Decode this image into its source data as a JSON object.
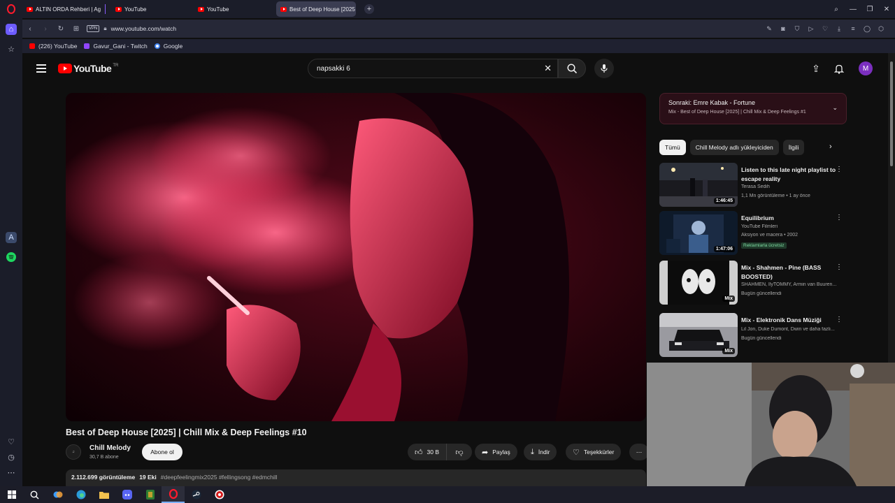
{
  "browser": {
    "tabs": [
      {
        "title": "ALTIN ORDA Rehberi | Ag",
        "active": false
      },
      {
        "title": "YouTube",
        "active": false
      },
      {
        "title": "YouTube",
        "active": false
      },
      {
        "title": "Best of Deep House [2025",
        "active": true
      }
    ],
    "vpn_label": "VPN",
    "url": "www.youtube.com/watch",
    "bookmarks": [
      "(226) YouTube",
      "Gavur_Gani - Twitch",
      "Google"
    ]
  },
  "youtube": {
    "logo_text": "YouTube",
    "logo_country": "TR",
    "search_value": "napsakki 6",
    "avatar_letter": "M",
    "video": {
      "title": "Best of Deep House [2025] | Chill Mix & Deep Feelings #10",
      "channel": "Chill Melody",
      "subscribers": "30,7 B abone",
      "subscribe_label": "Abone ol",
      "likes": "30 B",
      "share_label": "Paylaş",
      "download_label": "İndir",
      "thanks_label": "Teşekkürler",
      "views": "2.112.699 görüntüleme",
      "date": "19 Eki",
      "hashtags": "#deepfeelingmix2025 #fellingsong #edmchill"
    },
    "up_next": {
      "label": "Sonraki: Emre Kabak - Fortune",
      "playlist": "Mix - Best of Deep House [2025] | Chill Mix & Deep Feelings #1"
    },
    "chips": [
      "Tümü",
      "Chill Melody adlı yükleyiciden",
      "İlgili"
    ],
    "recommendations": [
      {
        "title": "Listen to this late night playlist to escape reality",
        "channel": "Terasa Sedih",
        "meta": "1,1 Mn görüntüleme • 1 ay önce",
        "duration": "1:46:45",
        "badge": ""
      },
      {
        "title": "Equilibrium",
        "channel": "YouTube Filmleri",
        "meta": "Aksiyon ve macera • 2002",
        "duration": "1:47:06",
        "badge": "Reklamlarla ücretsiz"
      },
      {
        "title": "Mix - Shahmen - Pine (BASS BOOSTED)",
        "channel": "SHAHMEN, IlyTOMMY, Armin van Buuren...",
        "meta": "Bugün güncellendi",
        "duration": "Mix",
        "badge": ""
      },
      {
        "title": "Mix - Elektronik Dans Müziği",
        "channel": "Lil Jon, Duke Dumont, Dwin ve daha fazlı...",
        "meta": "Bugün güncellendi",
        "duration": "Mix",
        "badge": ""
      }
    ]
  }
}
